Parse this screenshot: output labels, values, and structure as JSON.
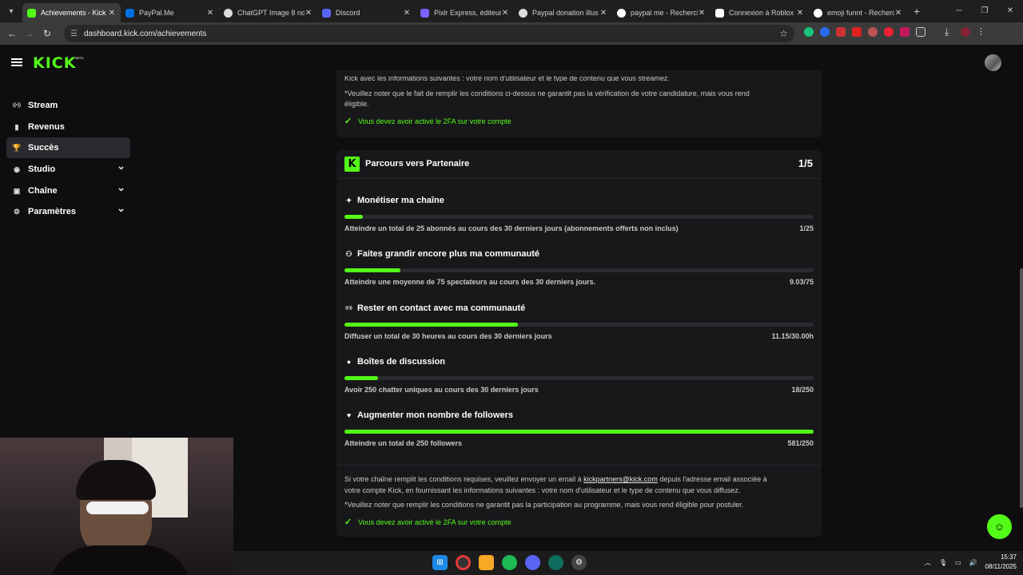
{
  "browser": {
    "tabs": [
      {
        "title": "Achievements - Kick",
        "active": true,
        "icon": "kick-favicon"
      },
      {
        "title": "PayPal.Me",
        "active": false,
        "icon": "paypal-favicon"
      },
      {
        "title": "ChatGPT Image 8 nov",
        "active": false,
        "icon": "chatgpt-favicon"
      },
      {
        "title": "Discord",
        "active": false,
        "icon": "discord-favicon"
      },
      {
        "title": "Pixlr Express, éditeur",
        "active": false,
        "icon": "pixlr-favicon"
      },
      {
        "title": "Paypal donation illus",
        "active": false,
        "icon": "chatgpt-favicon"
      },
      {
        "title": "paypal me - Recherch",
        "active": false,
        "icon": "google-favicon"
      },
      {
        "title": "Connexion à Roblox",
        "active": false,
        "icon": "roblox-favicon"
      },
      {
        "title": "emoji funnt - Recherc",
        "active": false,
        "icon": "google-favicon"
      }
    ],
    "url": "dashboard.kick.com/achievements"
  },
  "sidebar": {
    "logo": "KICK",
    "logo_badge": "BETA",
    "items": [
      {
        "label": "Stream",
        "icon": "broadcast-icon",
        "active": false,
        "expandable": false
      },
      {
        "label": "Revenus",
        "icon": "chart-icon",
        "active": false,
        "expandable": false
      },
      {
        "label": "Succès",
        "icon": "trophy-icon",
        "active": true,
        "expandable": false
      },
      {
        "label": "Studio",
        "icon": "camera-icon",
        "active": false,
        "expandable": true
      },
      {
        "label": "Chaîne",
        "icon": "channel-icon",
        "active": false,
        "expandable": true
      },
      {
        "label": "Paramètres",
        "icon": "gear-icon",
        "active": false,
        "expandable": true
      }
    ]
  },
  "top_card": {
    "line1": "Kick avec les informations suivantes : votre nom d'utilisateur et le type de contenu que vous streamez.",
    "line2": "*Veuillez noter que le fait de remplir les conditions ci-dessus ne garantit pas la vérification de votre candidature, mais vous rend",
    "line3": "éligible.",
    "twofa": "Vous devez avoir activé le 2FA sur votre compte"
  },
  "partner": {
    "title": "Parcours vers Partenaire",
    "progress": "1/5",
    "goals": [
      {
        "title": "Monétiser ma chaîne",
        "icon": "sparkle-icon",
        "desc": "Atteindre un total de 25 abonnés au cours des 30 derniers jours (abonnements offerts non inclus)",
        "value": "1/25",
        "fraction": 0.04
      },
      {
        "title": "Faites grandir encore plus ma communauté",
        "icon": "community-icon",
        "desc": "Atteindre une moyenne de 75 spectateurs au cours des 30 derniers jours.",
        "value": "9.03/75",
        "fraction": 0.12
      },
      {
        "title": "Rester en contact avec ma communauté",
        "icon": "broadcast-icon",
        "desc": "Diffuser un total de 30 heures au cours des 30 derniers jours",
        "value": "11.15/30.00h",
        "fraction": 0.37
      },
      {
        "title": "Boîtes de discussion",
        "icon": "chat-icon",
        "desc": "Avoir 250 chatter uniques au cours des 30 derniers jours",
        "value": "18/250",
        "fraction": 0.072
      },
      {
        "title": "Augmenter mon nombre de followers",
        "icon": "heart-icon",
        "desc": "Atteindre un total de 250 followers",
        "value": "581/250",
        "fraction": 1.0
      }
    ],
    "footer_pre": "Si votre chaîne remplit les conditions requises, veuillez envoyer un email à ",
    "footer_email": "kickpartners@kick.com",
    "footer_post": " depuis l'adresse email associée à",
    "footer_line2": "votre compte Kick, en fournissant les informations suivantes : votre nom d'utilisateur et le type de contenu que vous diffusez.",
    "footer_note": "*Veuillez noter que remplir les conditions ne garantit pas la participation au programme, mais vous rend éligible pour postuler.",
    "twofa": "Vous devez avoir activé le 2FA sur votre compte"
  },
  "taskbar": {
    "time": "15:37",
    "date": "08/11/2025"
  },
  "colors": {
    "accent": "#53fc18",
    "card": "#18181b",
    "background": "#0e0e10"
  }
}
